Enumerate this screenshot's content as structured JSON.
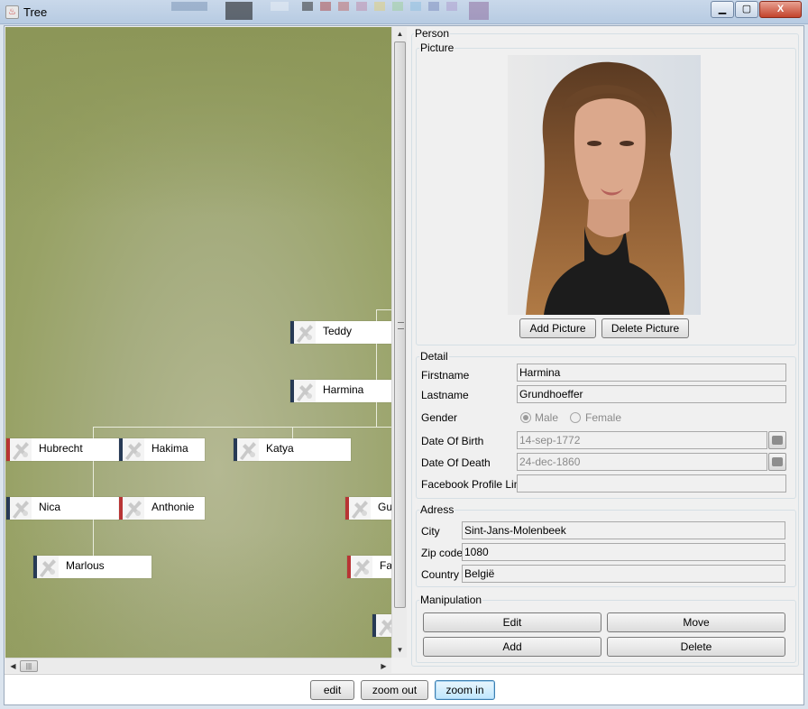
{
  "window": {
    "title": "Tree",
    "min_symbol": "▁",
    "max_symbol": "▢",
    "close_symbol": "X"
  },
  "tree": {
    "nodes": [
      {
        "name": "Teddy",
        "gender": "male"
      },
      {
        "name": "Harmina",
        "gender": "male"
      },
      {
        "name": "Hubrecht",
        "gender": "female"
      },
      {
        "name": "Hakima",
        "gender": "male"
      },
      {
        "name": "Katya",
        "gender": "male"
      },
      {
        "name": "Nica",
        "gender": "male"
      },
      {
        "name": "Anthonie",
        "gender": "female"
      },
      {
        "name": "Gus",
        "gender": "female"
      },
      {
        "name": "Marlous",
        "gender": "male"
      },
      {
        "name": "Fa",
        "gender": "female"
      },
      {
        "name": "",
        "gender": "male"
      }
    ],
    "colors": {
      "male": "#273a55",
      "female": "#b83434"
    }
  },
  "scroll": {
    "up": "▲",
    "down": "▼",
    "left": "◀",
    "right": "▶",
    "grip": "|||"
  },
  "person": {
    "title": "Person",
    "picture": {
      "label": "Picture",
      "add_label": "Add Picture",
      "delete_label": "Delete Picture"
    },
    "detail": {
      "label": "Detail",
      "firstname_label": "Firstname",
      "firstname": "Harmina",
      "lastname_label": "Lastname",
      "lastname": "Grundhoeffer",
      "gender_label": "Gender",
      "male_label": "Male",
      "female_label": "Female",
      "gender_selected": "Male",
      "dob_label": "Date Of Birth",
      "dob": "14-sep-1772",
      "dod_label": "Date Of Death",
      "dod": "24-dec-1860",
      "facebook_label": "Facebook Profile Link",
      "facebook": ""
    },
    "address": {
      "label": "Adress",
      "city_label": "City",
      "city": "Sint-Jans-Molenbeek",
      "zip_label": "Zip code",
      "zip": "1080",
      "country_label": "Country",
      "country": "België"
    },
    "manipulation": {
      "label": "Manipulation",
      "edit_label": "Edit",
      "move_label": "Move",
      "add_label": "Add",
      "delete_label": "Delete"
    }
  },
  "toolbar": {
    "edit_label": "edit",
    "zoom_out_label": "zoom out",
    "zoom_in_label": "zoom in"
  }
}
